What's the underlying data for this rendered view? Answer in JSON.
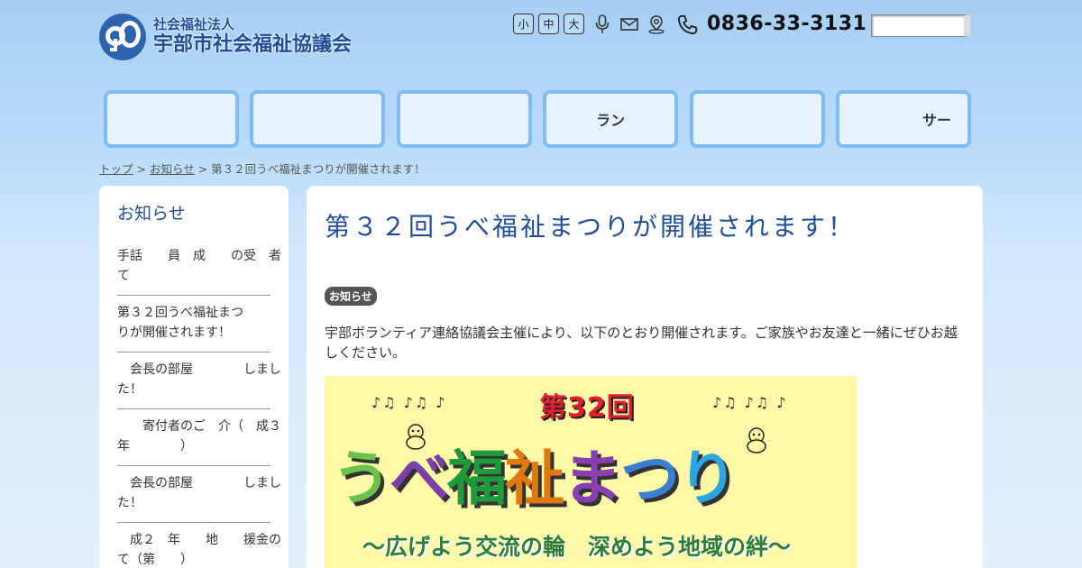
{
  "header": {
    "org_type": "社会福祉法人",
    "org_name": "宇部市社会福祉協議会",
    "font_size_buttons": [
      "小",
      "中",
      "大"
    ],
    "phone": "0836-33-3131",
    "search_placeholder": ""
  },
  "nav": {
    "items": [
      "",
      "",
      "",
      "ラン",
      "",
      "サー"
    ]
  },
  "breadcrumb": {
    "home": "トップ",
    "section": "お知らせ",
    "current": "> 第３２回うべ福祉まつりが開催されます！"
  },
  "sidebar": {
    "title": "お知らせ",
    "items": [
      "手話　　員　成　　の受　者\nて",
      "第３２回うべ福祉まつ\nりが開催されます！",
      "　会長の部屋　　　　しまし\nた！",
      "　　寄付者のご　介（　成３\n年　　　　）",
      "　会長の部屋　　　　しまし\nた！",
      "　成２　年　　地　　援金の\nて（第　　）"
    ]
  },
  "article": {
    "title": "第３２回うべ福祉まつりが開催されます！",
    "category": "お知らせ",
    "intro": "宇部ボランティア連絡協議会主催により、以下のとおり開催されます。ご家族やお友達と一緒にぜひお越しください。",
    "poster": {
      "edition": "第32回",
      "chars": [
        "う",
        "べ",
        "福",
        "祉",
        "ま",
        "つ",
        "り"
      ],
      "char_colors": [
        "#6cc24a",
        "#7a3fa8",
        "#1e9a3a",
        "#e07a10",
        "#8a3fb0",
        "#3a7fd0",
        "#2aa6e0"
      ],
      "subtitle": "〜広げよう交流の輪　深めよう地域の絆〜",
      "notes_left": "♪♫ ♪♫ ♪",
      "notes_right": "♪♫ ♪♫ ♪"
    }
  },
  "colors": {
    "brand": "#1f4e96",
    "nav_border": "#7fbcf1",
    "nav_bg": "#e6f2fe"
  }
}
